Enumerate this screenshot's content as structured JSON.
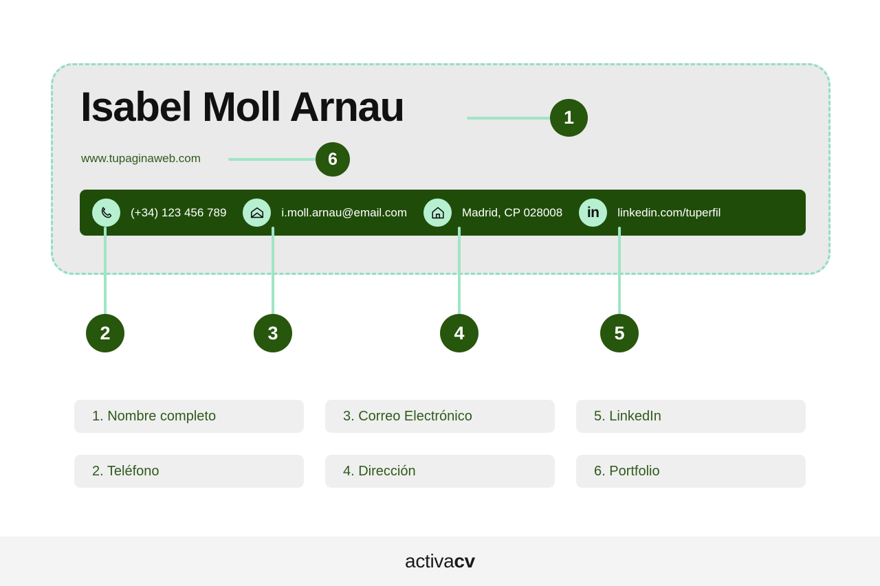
{
  "cv_card": {
    "name": "Isabel Moll Arnau",
    "website": "www.tupaginaweb.com",
    "contacts": [
      {
        "icon": "phone-icon",
        "text": "(+34) 123 456 789"
      },
      {
        "icon": "envelope-icon",
        "text": "i.moll.arnau@email.com"
      },
      {
        "icon": "home-icon",
        "text": "Madrid, CP 028008"
      },
      {
        "icon": "linkedin-icon",
        "text": "linkedin.com/tuperfil",
        "glyph": "in"
      }
    ]
  },
  "markers": {
    "m1": "1",
    "m2": "2",
    "m3": "3",
    "m4": "4",
    "m5": "5",
    "m6": "6"
  },
  "legend": {
    "items": [
      {
        "label": "1. Nombre completo"
      },
      {
        "label": "2. Teléfono"
      },
      {
        "label": "3. Correo Electrónico"
      },
      {
        "label": "4. Dirección"
      },
      {
        "label": "5. LinkedIn"
      },
      {
        "label": "6. Portfolio"
      }
    ]
  },
  "footer": {
    "brand_light": "activa",
    "brand_bold": "cv"
  },
  "colors": {
    "dark_green": "#1f4d09",
    "marker_green": "#27560d",
    "mint": "#9fe5c5",
    "icon_mint": "#b6f0d1",
    "panel_gray": "#eaeaea",
    "legend_gray": "#efefef",
    "text_green": "#2f5a1c",
    "footer_gray": "#f4f4f4"
  }
}
